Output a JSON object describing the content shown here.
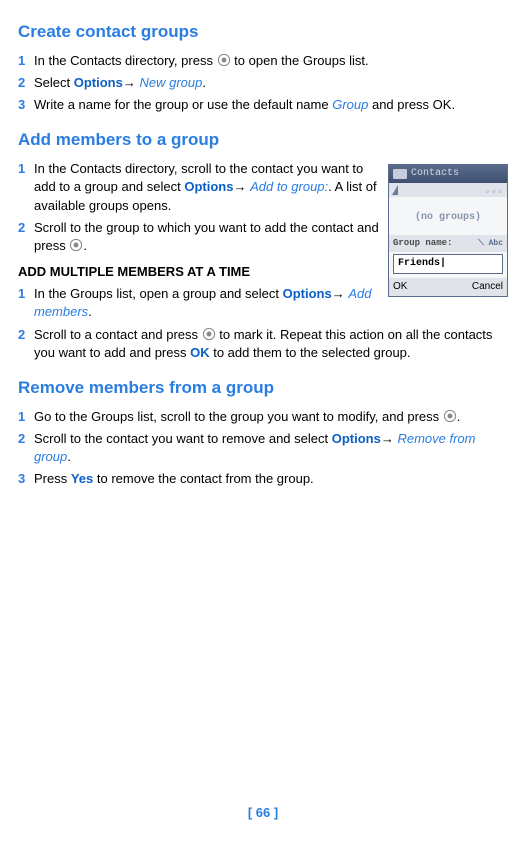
{
  "section1": {
    "heading": "Create contact groups",
    "steps": [
      {
        "num": "1",
        "pre": "In the Contacts directory, press ",
        "post": " to open the Groups list."
      },
      {
        "num": "2",
        "pre": "Select ",
        "opt": "Options",
        "arrow": "→ ",
        "italic": "New group",
        "post": "."
      },
      {
        "num": "3",
        "pre": "Write a name for the group or use the default name ",
        "italic": "Group",
        "post": " and press OK."
      }
    ]
  },
  "section2": {
    "heading": "Add members to a group",
    "steps": [
      {
        "num": "1",
        "pre": "In the Contacts directory, scroll to the contact you want to add to a group and select ",
        "opt": "Options",
        "arrow": "→ ",
        "italic": "Add to group:",
        "post": ". A list of available groups opens."
      },
      {
        "num": "2",
        "pre": "Scroll to the group to which you want to add the contact and press ",
        "post": "."
      }
    ],
    "subheading": "ADD MULTIPLE MEMBERS AT A TIME",
    "substeps": [
      {
        "num": "1",
        "pre": "In the Groups list, open a group and select ",
        "opt": "Options",
        "arrow": "→ ",
        "italic": "Add members",
        "post": "."
      },
      {
        "num": "2",
        "pre": "Scroll to a contact and press ",
        "mid": " to mark it. Repeat this action on all the contacts you want to add and press ",
        "ok": "OK",
        "post": " to add them to the selected group."
      }
    ]
  },
  "section3": {
    "heading": "Remove members from a group",
    "steps": [
      {
        "num": "1",
        "pre": "Go to the Groups list, scroll to the group you want to modify, and press ",
        "post": "."
      },
      {
        "num": "2",
        "pre": "Scroll to the contact you want to remove and select ",
        "opt": "Options",
        "arrow": "→ ",
        "italic": "Remove from group",
        "post": "."
      },
      {
        "num": "3",
        "pre": "Press ",
        "ok": "Yes",
        "post": " to remove the contact from the group."
      }
    ]
  },
  "phone": {
    "title": "Contacts",
    "empty": "(no groups)",
    "label": "Group name:",
    "abc": "⟍ Abc",
    "input": "Friends|",
    "softL": "OK",
    "softR": "Cancel"
  },
  "footer": "[ 66 ]"
}
